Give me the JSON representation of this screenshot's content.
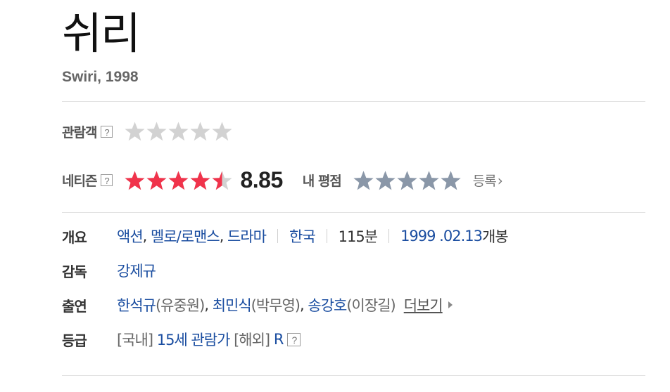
{
  "movie": {
    "title": "쉬리",
    "subtitle": "Swiri, 1998"
  },
  "ratings": {
    "audience": {
      "label": "관람객",
      "help": "?",
      "stars": 0
    },
    "netizen": {
      "label": "네티즌",
      "help": "?",
      "stars": 4.5,
      "score": "8.85"
    },
    "my_rating": {
      "label": "내 평점",
      "stars": 0,
      "register_label": "등록",
      "register_chevron": "›"
    }
  },
  "info": {
    "overview": {
      "label": "개요",
      "genres": [
        "액션",
        "멜로/로맨스",
        "드라마"
      ],
      "country": "한국",
      "runtime": "115분",
      "release_date": "1999 .02.13",
      "release_suffix": "개봉"
    },
    "director": {
      "label": "감독",
      "name": "강제규"
    },
    "cast": {
      "label": "출연",
      "members": [
        {
          "actor": "한석규",
          "role": "(유중원)"
        },
        {
          "actor": "최민식",
          "role": "(박무영)"
        },
        {
          "actor": "송강호",
          "role": "(이장길)"
        }
      ],
      "more_label": "더보기"
    },
    "grade": {
      "label": "등급",
      "domestic_tag": "[국내]",
      "domestic_rating": "15세 관람가",
      "overseas_tag": "[해외]",
      "overseas_rating": "R",
      "help": "?"
    }
  },
  "colors": {
    "star_empty": "#d2d2d2",
    "star_netizen": "#f0334b",
    "star_my": "#8a97a8",
    "link_blue": "#1a4da0"
  }
}
